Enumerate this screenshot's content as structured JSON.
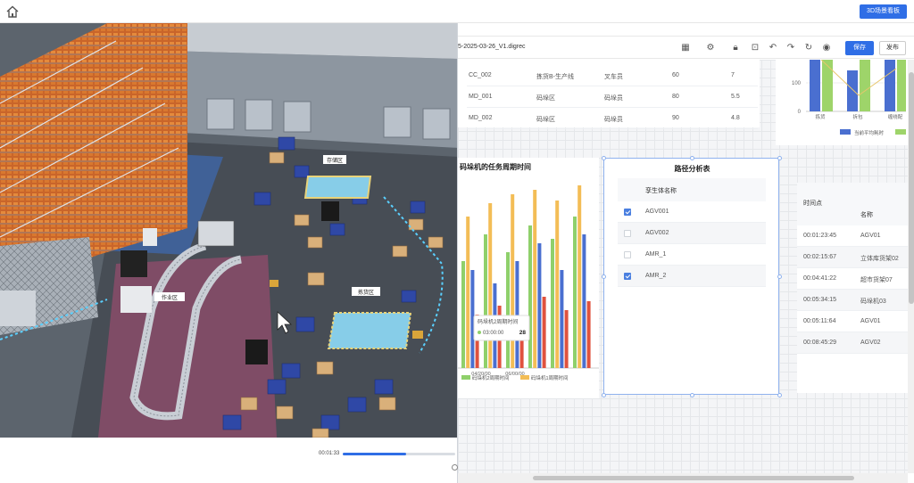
{
  "topbar": {
    "button_label": "3D场景看板"
  },
  "playback": {
    "time": "00:01:33",
    "progress": 0.56
  },
  "editor": {
    "filename": "5-2025-03-26_V1.digrec",
    "save_label": "保存",
    "publish_label": "发布"
  },
  "scene_labels": {
    "zone_a": "存储区",
    "zone_b": "作业区",
    "zone_c": "拣货区"
  },
  "table1": {
    "rows": [
      [
        "CC_002",
        "拣货B-生产线",
        "叉车员",
        "60",
        "7"
      ],
      [
        "MD_001",
        "码垛区",
        "码垛员",
        "80",
        "5.5"
      ],
      [
        "MD_002",
        "码垛区",
        "码垛员",
        "90",
        "4.8"
      ]
    ]
  },
  "chart_top_right": {
    "type": "bar",
    "y_ticks": [
      "100",
      "0"
    ],
    "categories": [
      "拣货",
      "拆包",
      "缠绕配"
    ],
    "legend": [
      "当前平均耗时"
    ],
    "colors": {
      "series1": "#4a6fd0",
      "series2": "#9ed46a",
      "line": "#e8c66c"
    }
  },
  "chart_data": {
    "type": "bar",
    "title": "码垛机的任务周期时间",
    "x_ticks": [
      "04/20/00",
      "06/00/00"
    ],
    "legend": [
      "码垛机2周期时间",
      "码垛机1周期时间"
    ],
    "tooltip": {
      "label": "码垛机2周期时间",
      "time": "03:00:00",
      "value": "28"
    },
    "colors": {
      "green": "#8fd06b",
      "orange": "#f3bd56",
      "blue": "#4a6fd0",
      "red": "#e0523e"
    }
  },
  "path_analysis": {
    "title": "路径分析表",
    "header": "孪生体名称",
    "rows": [
      {
        "name": "AGV001",
        "checked": true
      },
      {
        "name": "AGV002",
        "checked": false
      },
      {
        "name": "AMR_1",
        "checked": false
      },
      {
        "name": "AMR_2",
        "checked": true
      }
    ]
  },
  "table5": {
    "header_time": "时间点",
    "header_name": "名称",
    "rows": [
      [
        "00:01:23:45",
        "AGV01"
      ],
      [
        "00:02:15:67",
        "立体库货架02"
      ],
      [
        "00:04:41:22",
        "超市货架07"
      ],
      [
        "00:05:34:15",
        "码垛机03"
      ],
      [
        "00:05:11:64",
        "AGV01"
      ],
      [
        "00:08:45:29",
        "AGV02"
      ]
    ]
  }
}
